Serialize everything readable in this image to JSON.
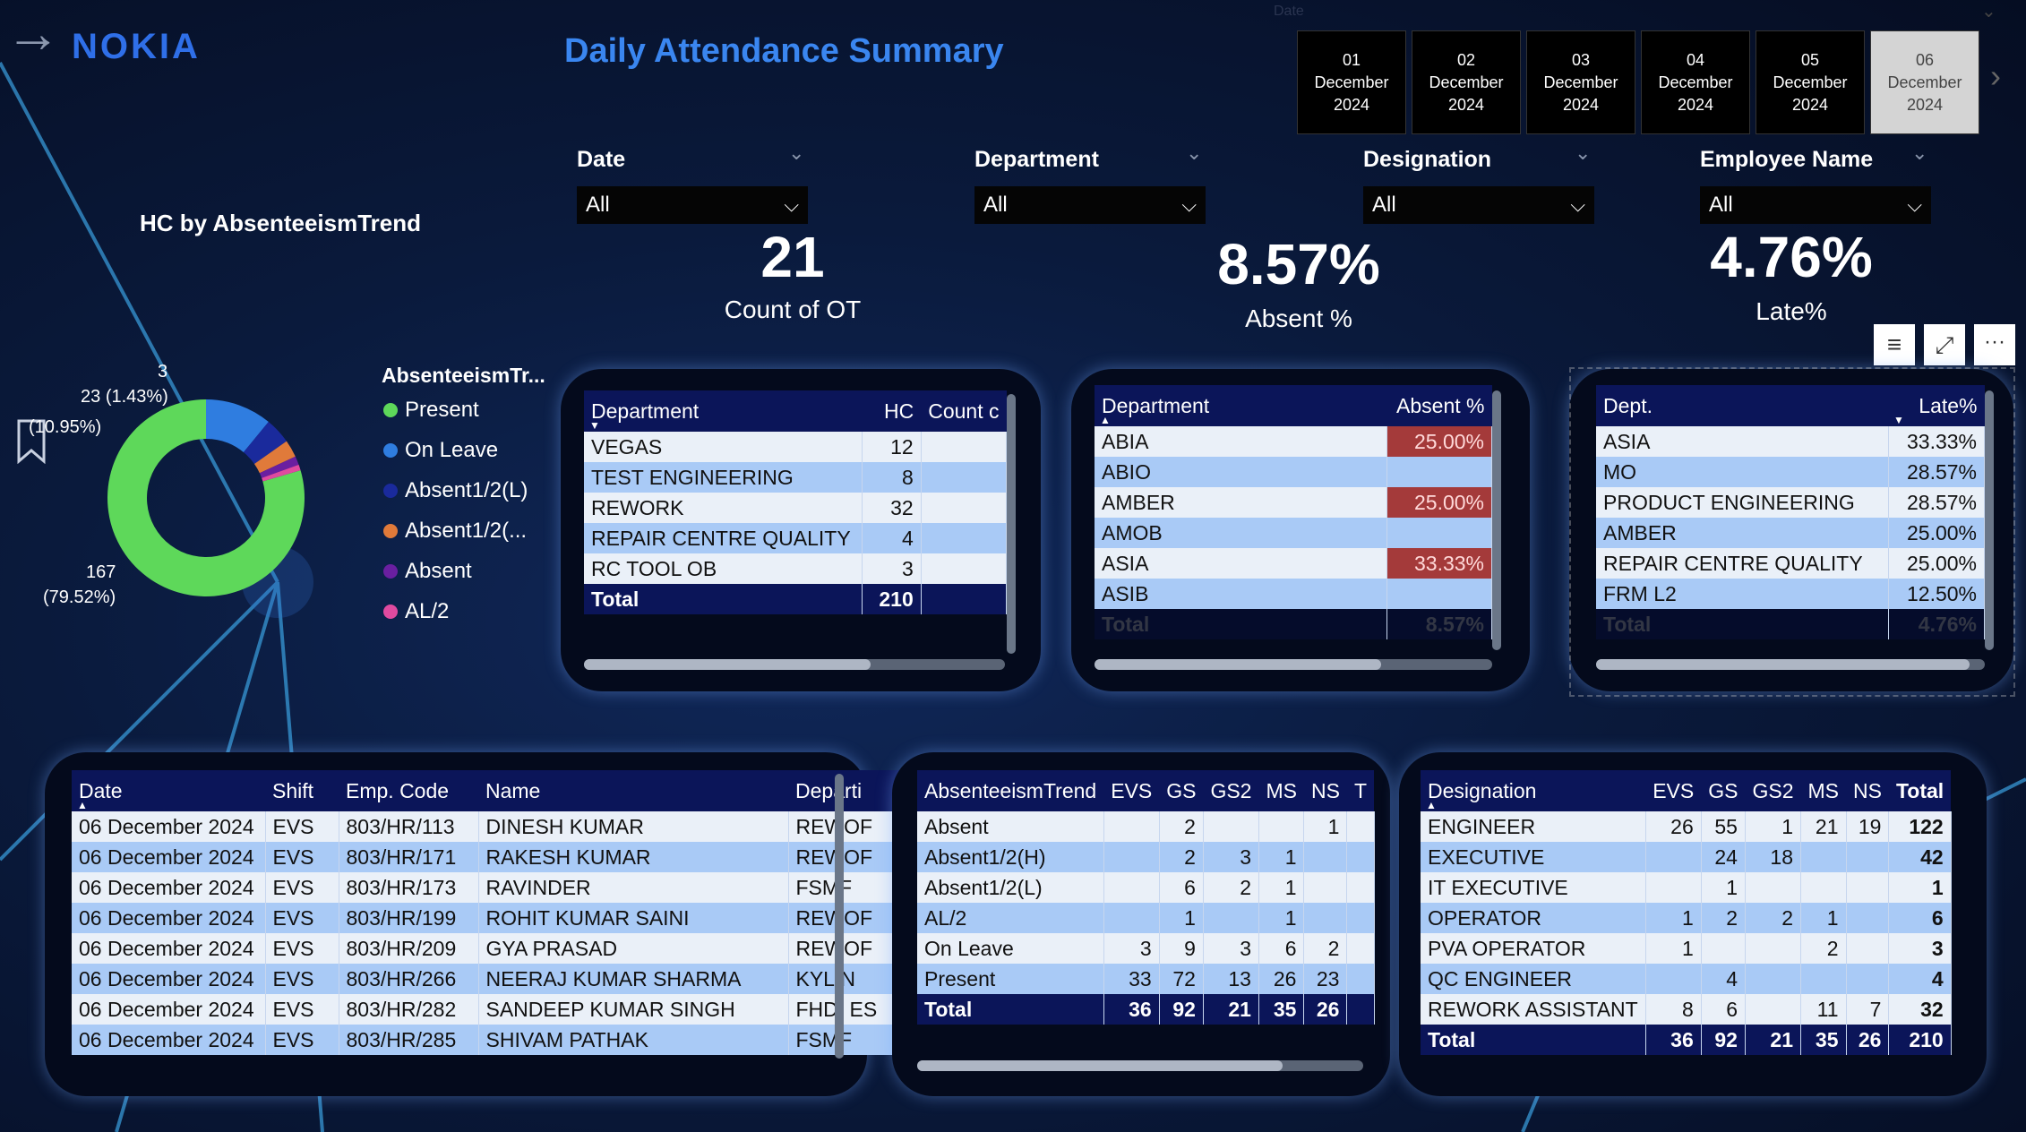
{
  "app": {
    "logo": "NOKIA",
    "title": "Daily Attendance Summary",
    "slicer_title": "Date"
  },
  "date_tiles": [
    {
      "day": "01",
      "month": "December",
      "year": "2024",
      "selected": false
    },
    {
      "day": "02",
      "month": "December",
      "year": "2024",
      "selected": false
    },
    {
      "day": "03",
      "month": "December",
      "year": "2024",
      "selected": false
    },
    {
      "day": "04",
      "month": "December",
      "year": "2024",
      "selected": false
    },
    {
      "day": "05",
      "month": "December",
      "year": "2024",
      "selected": false
    },
    {
      "day": "06",
      "month": "December",
      "year": "2024",
      "selected": true
    }
  ],
  "filters": [
    {
      "label": "Date",
      "value": "All"
    },
    {
      "label": "Department",
      "value": "All"
    },
    {
      "label": "Designation",
      "value": "All"
    },
    {
      "label": "Employee Name",
      "value": "All"
    }
  ],
  "kpis": {
    "ot": {
      "value": "21",
      "label": "Count of OT"
    },
    "absent": {
      "value": "8.57%",
      "label": "Absent %"
    },
    "late": {
      "value": "4.76%",
      "label": "Late%"
    }
  },
  "donut": {
    "title": "HC by AbsenteeismTrend",
    "legend_title": "AbsenteeismTr...",
    "legend": [
      {
        "label": "Present",
        "color": "#5ed85a"
      },
      {
        "label": "On Leave",
        "color": "#2f7de0"
      },
      {
        "label": "Absent1/2(L)",
        "color": "#1a2a9c"
      },
      {
        "label": "Absent1/2(...",
        "color": "#e07a3a"
      },
      {
        "label": "Absent",
        "color": "#6a1fa0"
      },
      {
        "label": "AL/2",
        "color": "#e04aa0"
      }
    ],
    "labels": {
      "a": "3",
      "b": "23",
      "b_pct": "(1.43%)",
      "c_pct": "(10.95%)",
      "d": "167",
      "d_pct": "(79.52%)"
    }
  },
  "chart_data": {
    "type": "pie",
    "title": "HC by AbsenteeismTrend",
    "legend_title": "AbsenteeismTr...",
    "categories": [
      "Present",
      "On Leave",
      "Absent1/2(L)",
      "Absent1/2(H)",
      "Absent",
      "AL/2"
    ],
    "values": [
      167,
      23,
      9,
      6,
      3,
      2
    ]
  },
  "dept_table": {
    "headers": [
      "Department",
      "HC",
      "Count c"
    ],
    "rows": [
      [
        "VEGAS",
        "12",
        ""
      ],
      [
        "TEST ENGINEERING",
        "8",
        ""
      ],
      [
        "REWORK",
        "32",
        ""
      ],
      [
        "REPAIR CENTRE QUALITY",
        "4",
        ""
      ],
      [
        "RC TOOL OB",
        "3",
        ""
      ]
    ],
    "total": [
      "Total",
      "210",
      ""
    ]
  },
  "absent_table": {
    "headers": [
      "Department",
      "Absent %"
    ],
    "rows": [
      [
        "ABIA",
        "25.00%"
      ],
      [
        "ABIO",
        ""
      ],
      [
        "AMBER",
        "25.00%"
      ],
      [
        "AMOB",
        ""
      ],
      [
        "ASIA",
        "33.33%"
      ],
      [
        "ASIB",
        ""
      ]
    ],
    "total": [
      "Total",
      "8.57%"
    ]
  },
  "late_table": {
    "headers": [
      "Dept.",
      "Late%"
    ],
    "rows": [
      [
        "ASIA",
        "33.33%"
      ],
      [
        "MO",
        "28.57%"
      ],
      [
        "PRODUCT ENGINEERING",
        "28.57%"
      ],
      [
        "AMBER",
        "25.00%"
      ],
      [
        "REPAIR CENTRE QUALITY",
        "25.00%"
      ],
      [
        "FRM L2",
        "12.50%"
      ]
    ],
    "total": [
      "Total",
      "4.76%"
    ]
  },
  "emp_table": {
    "headers": [
      "Date",
      "Shift",
      "Emp. Code",
      "Name",
      "Departi"
    ],
    "rows": [
      [
        "06 December 2024",
        "EVS",
        "803/HR/113",
        "DINESH KUMAR",
        "REWOF"
      ],
      [
        "06 December 2024",
        "EVS",
        "803/HR/171",
        "RAKESH KUMAR",
        "REWOF"
      ],
      [
        "06 December 2024",
        "EVS",
        "803/HR/173",
        "RAVINDER",
        "FSMF"
      ],
      [
        "06 December 2024",
        "EVS",
        "803/HR/199",
        "ROHIT KUMAR SAINI",
        "REWOF"
      ],
      [
        "06 December 2024",
        "EVS",
        "803/HR/209",
        "GYA PRASAD",
        "REWOF"
      ],
      [
        "06 December 2024",
        "EVS",
        "803/HR/266",
        "NEERAJ KUMAR SHARMA",
        "KYLIN"
      ],
      [
        "06 December 2024",
        "EVS",
        "803/HR/282",
        "SANDEEP KUMAR SINGH",
        "FHDI ES"
      ],
      [
        "06 December 2024",
        "EVS",
        "803/HR/285",
        "SHIVAM PATHAK",
        "FSMF"
      ]
    ]
  },
  "trend_table": {
    "headers": [
      "AbsenteeismTrend",
      "EVS",
      "GS",
      "GS2",
      "MS",
      "NS",
      "T"
    ],
    "rows": [
      [
        "Absent",
        "",
        "2",
        "",
        "",
        "1",
        ""
      ],
      [
        "Absent1/2(H)",
        "",
        "2",
        "3",
        "1",
        "",
        ""
      ],
      [
        "Absent1/2(L)",
        "",
        "6",
        "2",
        "1",
        "",
        ""
      ],
      [
        "AL/2",
        "",
        "1",
        "",
        "1",
        "",
        ""
      ],
      [
        "On Leave",
        "3",
        "9",
        "3",
        "6",
        "2",
        ""
      ],
      [
        "Present",
        "33",
        "72",
        "13",
        "26",
        "23",
        ""
      ]
    ],
    "total": [
      "Total",
      "36",
      "92",
      "21",
      "35",
      "26",
      ""
    ]
  },
  "desig_table": {
    "headers": [
      "Designation",
      "EVS",
      "GS",
      "GS2",
      "MS",
      "NS",
      "Total"
    ],
    "rows": [
      [
        "ENGINEER",
        "26",
        "55",
        "1",
        "21",
        "19",
        "122"
      ],
      [
        "EXECUTIVE",
        "",
        "24",
        "18",
        "",
        "",
        "42"
      ],
      [
        "IT EXECUTIVE",
        "",
        "1",
        "",
        "",
        "",
        "1"
      ],
      [
        "OPERATOR",
        "1",
        "2",
        "2",
        "1",
        "",
        "6"
      ],
      [
        "PVA OPERATOR",
        "1",
        "",
        "",
        "2",
        "",
        "3"
      ],
      [
        "QC ENGINEER",
        "",
        "4",
        "",
        "",
        "",
        "4"
      ],
      [
        "REWORK ASSISTANT",
        "8",
        "6",
        "",
        "11",
        "7",
        "32"
      ]
    ],
    "total": [
      "Total",
      "36",
      "92",
      "21",
      "35",
      "26",
      "210"
    ]
  }
}
